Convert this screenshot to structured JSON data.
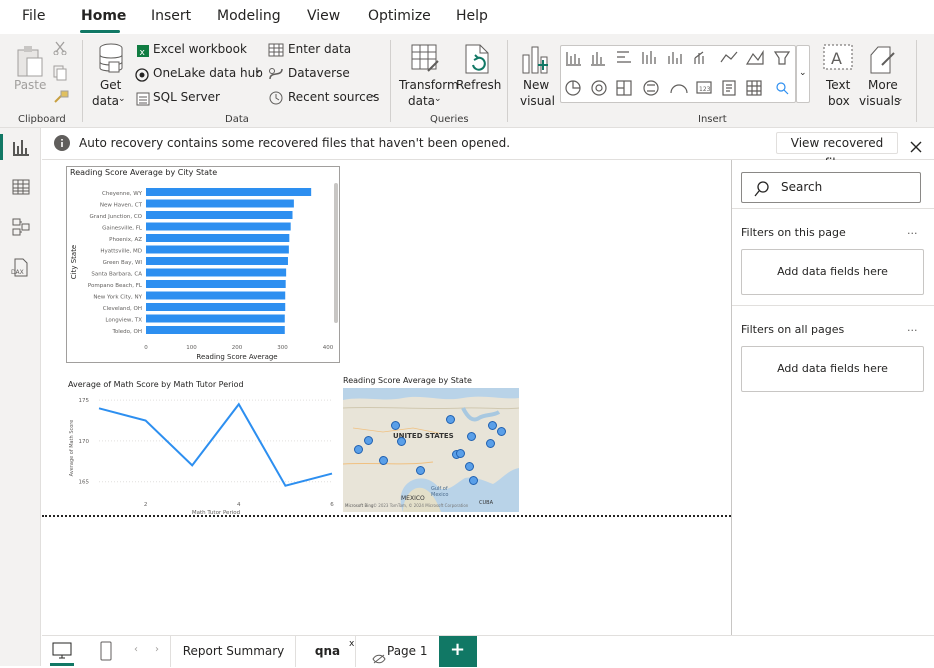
{
  "menu": {
    "items": [
      {
        "label": "File"
      },
      {
        "label": "Home"
      },
      {
        "label": "Insert"
      },
      {
        "label": "Modeling"
      },
      {
        "label": "View"
      },
      {
        "label": "Optimize"
      },
      {
        "label": "Help"
      }
    ]
  },
  "ribbon": {
    "clipboard": {
      "paste": "Paste",
      "group": "Clipboard"
    },
    "data": {
      "get_data_1": "Get",
      "get_data_2": "data",
      "excel": "Excel workbook",
      "onelake": "OneLake data hub",
      "sql": "SQL Server",
      "enter_data": "Enter data",
      "dataverse": "Dataverse",
      "recent": "Recent sources",
      "group": "Data"
    },
    "queries": {
      "transform_1": "Transform",
      "transform_2": "data",
      "refresh": "Refresh",
      "group": "Queries"
    },
    "insert": {
      "new_visual_1": "New",
      "new_visual_2": "visual",
      "text_box_1": "Text",
      "text_box_2": "box",
      "more_visuals_1": "More",
      "more_visuals_2": "visuals",
      "group": "Insert"
    }
  },
  "infobar": {
    "message": "Auto recovery contains some recovered files that haven't been opened.",
    "action": "View recovered files"
  },
  "filters": {
    "search_placeholder": "Search",
    "this_page": "Filters on this page",
    "all_pages": "Filters on all pages",
    "add_fields": "Add data fields here",
    "more": "..."
  },
  "tabs": [
    {
      "label": "Report Summary"
    },
    {
      "label": "qna"
    },
    {
      "label": "Page 1"
    }
  ],
  "colors": {
    "accent": "#117865",
    "bar": "#2d8ff0",
    "line": "#2d8ff0"
  },
  "chart_data": [
    {
      "type": "bar",
      "title": "Reading Score Average by City State",
      "xlabel": "Reading Score Average",
      "ylabel": "City State",
      "categories": [
        "Cheyenne, WY",
        "New Haven, CT",
        "Grand Junction, CO",
        "Gainesville, FL",
        "Phoenix, AZ",
        "Hyattsville, MD",
        "Green Bay, WI",
        "Santa Barbara, CA",
        "Pompano Beach, FL",
        "New York City, NY",
        "Cleveland, OH",
        "Longview, TX",
        "Toledo, OH"
      ],
      "values": [
        363,
        325,
        322,
        318,
        315,
        314,
        312,
        308,
        307,
        306,
        306,
        305,
        305
      ],
      "xlim": [
        0,
        400
      ],
      "xticks": [
        "0",
        "100",
        "200",
        "300",
        "400"
      ]
    },
    {
      "type": "line",
      "title": "Average of Math Score by Math Tutor Period",
      "xlabel": "Math Tutor Period",
      "ylabel": "Average of Math Score",
      "x": [
        1,
        2,
        3,
        4,
        5,
        6
      ],
      "values": [
        174,
        172.5,
        167,
        174.5,
        164.5,
        166
      ],
      "ylim": [
        163,
        176
      ],
      "yticks": [
        "165",
        "170",
        "175"
      ],
      "xticks": [
        "2",
        "4",
        "6"
      ]
    },
    {
      "type": "map",
      "title": "Reading Score Average by State",
      "labels": [
        "UNITED STATES",
        "MEXICO",
        "Gulf of Mexico",
        "CUBA"
      ],
      "attribution": "Microsoft Bing",
      "copyright": "© 2023 TomTom, © 2024 Microsoft Corporation"
    }
  ]
}
